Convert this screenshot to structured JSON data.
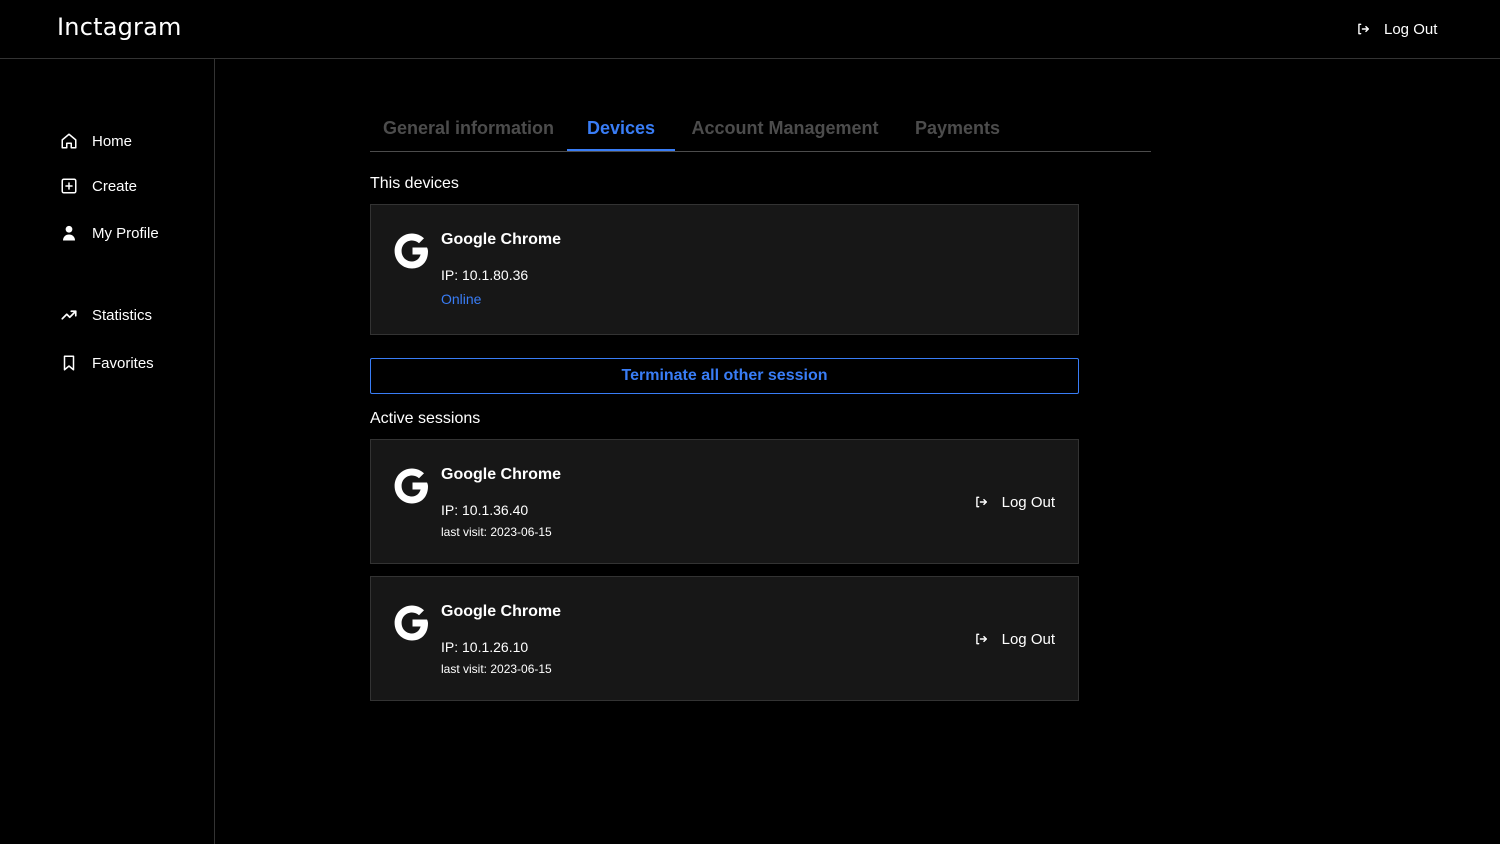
{
  "app": {
    "name": "Inctagram"
  },
  "header": {
    "logout_label": "Log Out",
    "logout_icon": "log-out-icon"
  },
  "sidebar": {
    "items": [
      {
        "label": "Home",
        "icon": "home-icon"
      },
      {
        "label": "Create",
        "icon": "plus-square-icon"
      },
      {
        "label": "My Profile",
        "icon": "person-icon"
      },
      {
        "label": "Statistics",
        "icon": "trending-up-icon"
      },
      {
        "label": "Favorites",
        "icon": "bookmark-icon"
      }
    ]
  },
  "tabs": [
    {
      "label": "General information",
      "active": false
    },
    {
      "label": "Devices",
      "active": true
    },
    {
      "label": "Account Management",
      "active": false
    },
    {
      "label": "Payments",
      "active": false
    }
  ],
  "this_device": {
    "title": "This devices",
    "browser": "Google Chrome",
    "icon": "google-icon",
    "ip": "IP: 10.1.80.36",
    "status": "Online"
  },
  "terminate_label": "Terminate all other session",
  "active_sessions": {
    "title": "Active sessions",
    "sessions": [
      {
        "browser": "Google Chrome",
        "icon": "google-icon",
        "ip": "IP: 10.1.36.40",
        "last_visit": "last visit: 2023-06-15",
        "logout_label": "Log Out"
      },
      {
        "browser": "Google Chrome",
        "icon": "google-icon",
        "ip": "IP: 10.1.26.10",
        "last_visit": "last visit: 2023-06-15",
        "logout_label": "Log Out"
      }
    ]
  },
  "colors": {
    "background": "#000000",
    "card": "#171717",
    "border": "#333333",
    "accent": "#397df6",
    "tab_inactive": "#4c4c4c",
    "text": "#ffffff"
  }
}
